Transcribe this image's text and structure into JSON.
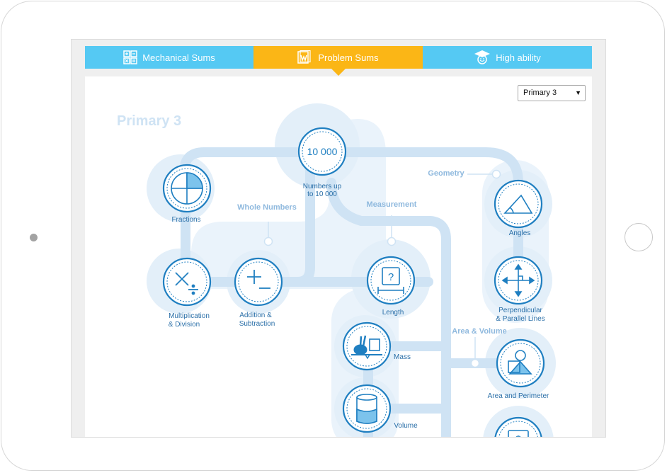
{
  "tabs": [
    {
      "label": "Mechanical Sums",
      "icon": "calculator-icon"
    },
    {
      "label": "Problem Sums",
      "icon": "notebook-icon"
    },
    {
      "label": "High ability",
      "icon": "graduation-cap-icon"
    }
  ],
  "level_select": {
    "value": "Primary 3"
  },
  "page_title": "Primary 3",
  "categories": {
    "whole_numbers": "Whole Numbers",
    "measurement": "Measurement",
    "geometry": "Geometry",
    "area_volume": "Area & Volume"
  },
  "topics": {
    "numbers_line1": "Numbers up",
    "numbers_line2": "to 10 000",
    "numbers_badge": "10 000",
    "fractions": "Fractions",
    "mult_line1": "Multiplication",
    "mult_line2": "& Division",
    "add_line1": "Addition &",
    "add_line2": "Subtraction",
    "length": "Length",
    "length_badge": "?",
    "mass": "Mass",
    "volume": "Volume",
    "angles": "Angles",
    "perp_line1": "Perpendicular",
    "perp_line2": "& Parallel Lines",
    "area_perimeter": "Area and Perimeter"
  },
  "colors": {
    "tab_blue": "#55c9f3",
    "tab_active": "#fbb616",
    "path": "#cfe3f4",
    "halo": "#e9f3fb",
    "node": "#1f7fc1",
    "label": "#2a6fa8",
    "category": "#8fb9de"
  }
}
